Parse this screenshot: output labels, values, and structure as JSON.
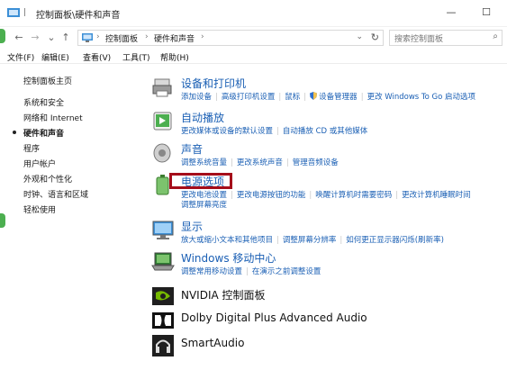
{
  "window": {
    "title": "控制面板\\硬件和声音",
    "title_sep": "|"
  },
  "titlebar_controls": {
    "minimize": "—",
    "maximize": "☐"
  },
  "nav": {
    "back": "←",
    "forward": "→",
    "recent": "⌄",
    "up": "↑"
  },
  "address": {
    "crumbs": [
      "控制面板",
      "硬件和声音"
    ],
    "sep": "›",
    "dropdown": "⌄",
    "refresh": "↻"
  },
  "search": {
    "placeholder": "搜索控制面板",
    "icon": "⌕"
  },
  "menu": [
    "文件(F)",
    "编辑(E)",
    "查看(V)",
    "工具(T)",
    "帮助(H)"
  ],
  "leftnav": {
    "home": "控制面板主页",
    "items": [
      "系统和安全",
      "网络和 Internet",
      "硬件和声音",
      "程序",
      "用户帐户",
      "外观和个性化",
      "时钟、语言和区域",
      "轻松使用"
    ]
  },
  "categories": [
    {
      "title": "设备和打印机",
      "links": [
        "添加设备",
        "高级打印机设置",
        "鼠标",
        "设备管理器",
        "更改 Windows To Go 启动选项"
      ]
    },
    {
      "title": "自动播放",
      "links": [
        "更改媒体或设备的默认设置",
        "自动播放 CD 或其他媒体"
      ]
    },
    {
      "title": "声音",
      "links": [
        "调整系统音量",
        "更改系统声音",
        "管理音频设备"
      ]
    },
    {
      "title": "电源选项",
      "links": [
        "更改电池设置",
        "更改电源按钮的功能",
        "唤醒计算机时需要密码",
        "更改计算机睡眠时间"
      ],
      "links2": [
        "调整屏幕亮度"
      ]
    },
    {
      "title": "显示",
      "links": [
        "放大或缩小文本和其他项目",
        "调整屏幕分辨率",
        "如何更正显示器闪烁(刷新率)"
      ]
    },
    {
      "title": "Windows 移动中心",
      "links": [
        "调整常用移动设置",
        "在演示之前调整设置"
      ]
    },
    {
      "title": "NVIDIA 控制面板",
      "links": []
    },
    {
      "title": "Dolby Digital Plus Advanced Audio",
      "links": []
    },
    {
      "title": "SmartAudio",
      "links": []
    }
  ],
  "colors": {
    "link": "#1a5fb4",
    "highlight": "#a50d1a"
  }
}
